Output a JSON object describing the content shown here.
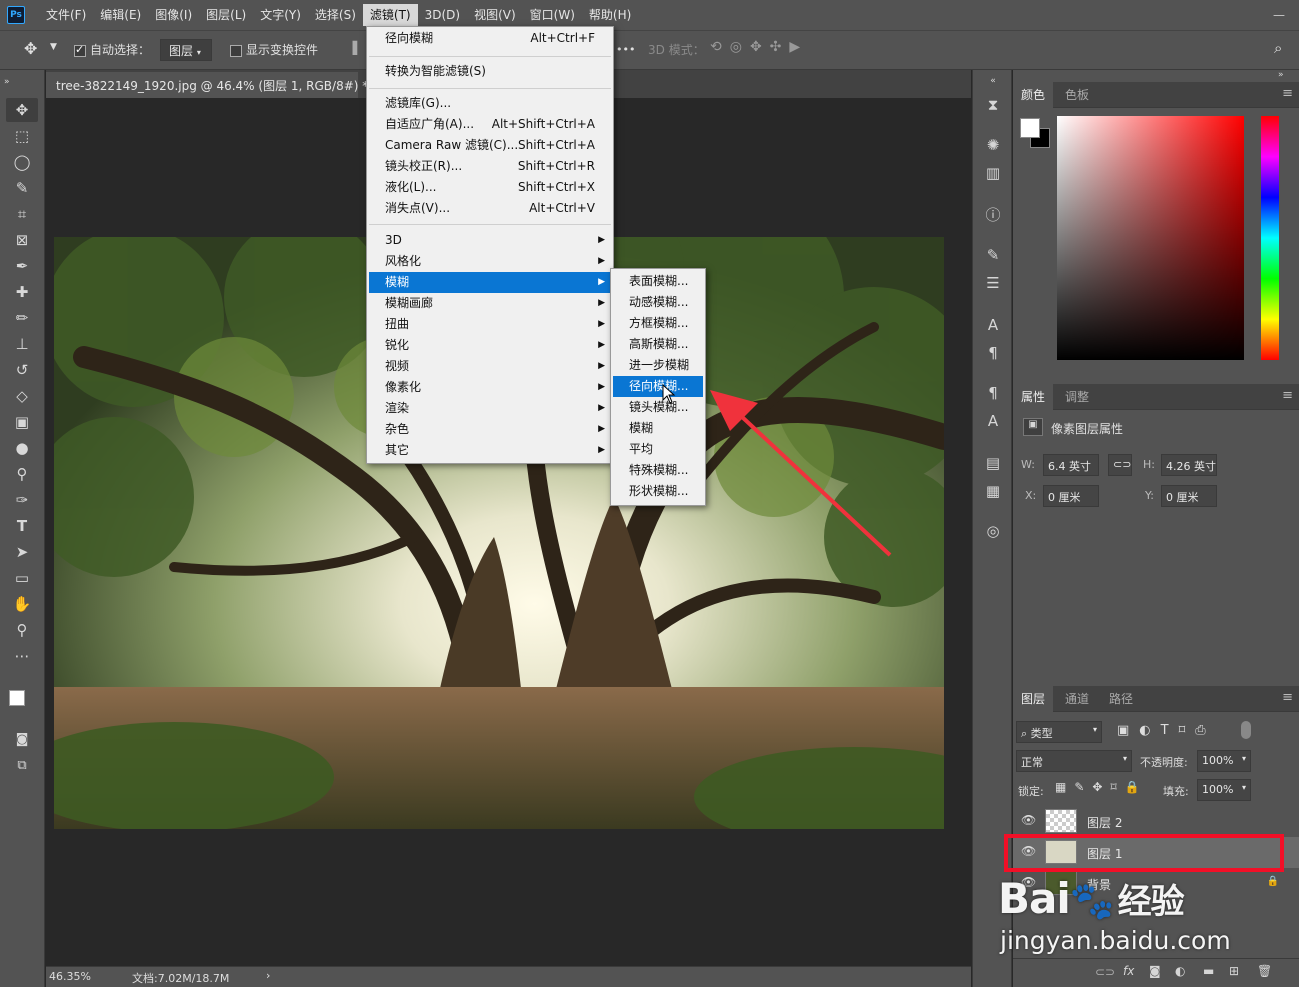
{
  "menubar": {
    "logo": "Ps",
    "items": [
      "文件(F)",
      "编辑(E)",
      "图像(I)",
      "图层(L)",
      "文字(Y)",
      "选择(S)",
      "滤镜(T)",
      "3D(D)",
      "视图(V)",
      "窗口(W)",
      "帮助(H)"
    ],
    "active": "滤镜(T)",
    "window_controls": "—"
  },
  "options": {
    "auto_select_label": "自动选择：",
    "auto_select_value": "图层",
    "show_transform_label": "显示变换控件",
    "mode_3d_label": "3D 模式：",
    "more": "•••"
  },
  "document": {
    "tab_title": "tree-3822149_1920.jpg @ 46.4% (图层 1, RGB/8#) *",
    "close": "×",
    "zoom": "46.35%",
    "doc_info": "文档:7.02M/18.7M",
    "status_arrow": "›"
  },
  "filter_menu": {
    "group1": [
      {
        "label": "径向模糊",
        "shortcut": "Alt+Ctrl+F"
      }
    ],
    "group2": [
      {
        "label": "转换为智能滤镜(S)"
      }
    ],
    "group3": [
      {
        "label": "滤镜库(G)...",
        "shortcut": ""
      },
      {
        "label": "自适应广角(A)...",
        "shortcut": "Alt+Shift+Ctrl+A"
      },
      {
        "label": "Camera Raw 滤镜(C)...",
        "shortcut": "Shift+Ctrl+A"
      },
      {
        "label": "镜头校正(R)...",
        "shortcut": "Shift+Ctrl+R"
      },
      {
        "label": "液化(L)...",
        "shortcut": "Shift+Ctrl+X"
      },
      {
        "label": "消失点(V)...",
        "shortcut": "Alt+Ctrl+V"
      }
    ],
    "group4": [
      "3D",
      "风格化",
      "模糊",
      "模糊画廊",
      "扭曲",
      "锐化",
      "视频",
      "像素化",
      "渲染",
      "杂色",
      "其它"
    ],
    "highlighted": "模糊"
  },
  "blur_submenu": {
    "items": [
      "表面模糊...",
      "动感模糊...",
      "方框模糊...",
      "高斯模糊...",
      "进一步模糊",
      "径向模糊...",
      "镜头模糊...",
      "模糊",
      "平均",
      "特殊模糊...",
      "形状模糊..."
    ],
    "highlighted": "径向模糊..."
  },
  "color_panel": {
    "tabs": [
      "颜色",
      "色板"
    ]
  },
  "properties_panel": {
    "tabs": [
      "属性",
      "调整"
    ],
    "title": "像素图层属性",
    "w_label": "W:",
    "w_value": "6.4 英寸",
    "h_label": "H:",
    "h_value": "4.26 英寸",
    "x_label": "X:",
    "x_value": "0 厘米",
    "y_label": "Y:",
    "y_value": "0 厘米"
  },
  "layers_panel": {
    "tabs": [
      "图层",
      "通道",
      "路径"
    ],
    "filter_kind": "类型",
    "blend_mode": "正常",
    "opacity_label": "不透明度:",
    "opacity_value": "100%",
    "lock_label": "锁定:",
    "fill_label": "填充:",
    "fill_value": "100%",
    "layers": [
      {
        "name": "图层 2"
      },
      {
        "name": "图层 1",
        "selected": true
      },
      {
        "name": "背景",
        "locked": true
      }
    ],
    "footer_icons": [
      "link-icon",
      "fx",
      "mask-icon",
      "adjustment-icon",
      "folder-icon",
      "new-layer-icon",
      "trash-icon"
    ],
    "fx_label": "fx"
  },
  "watermark": {
    "brand": "Bai",
    "brand2": "经验",
    "url": "jingyan.baidu.com"
  }
}
